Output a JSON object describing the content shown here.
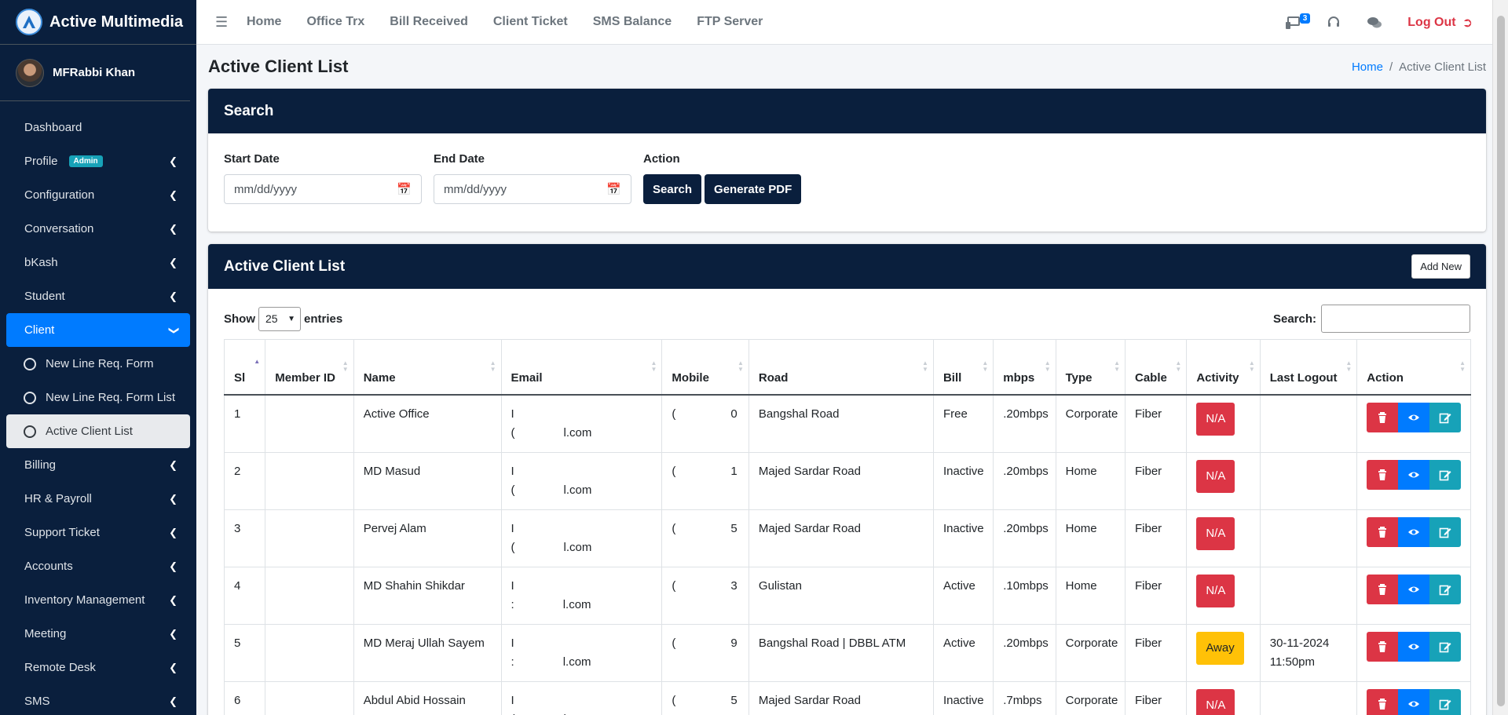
{
  "brand": {
    "name": "Active Multimedia"
  },
  "user": {
    "name": "MFRabbi Khan"
  },
  "sidebar": {
    "items": [
      {
        "label": "Dashboard"
      },
      {
        "label": "Profile",
        "badge": "Admin"
      },
      {
        "label": "Configuration"
      },
      {
        "label": "Conversation"
      },
      {
        "label": "bKash"
      },
      {
        "label": "Student"
      },
      {
        "label": "Client"
      },
      {
        "label": "New Line Req. Form"
      },
      {
        "label": "New Line Req. Form List"
      },
      {
        "label": "Active Client List"
      },
      {
        "label": "Billing"
      },
      {
        "label": "HR & Payroll"
      },
      {
        "label": "Support Ticket"
      },
      {
        "label": "Accounts"
      },
      {
        "label": "Inventory Management"
      },
      {
        "label": "Meeting"
      },
      {
        "label": "Remote Desk"
      },
      {
        "label": "SMS"
      }
    ]
  },
  "topnav": {
    "links": [
      "Home",
      "Office Trx",
      "Bill Received",
      "Client Ticket",
      "SMS Balance",
      "FTP Server"
    ],
    "notification_count": "3",
    "logout": "Log Out"
  },
  "page": {
    "title": "Active Client List",
    "breadcrumb_home": "Home",
    "breadcrumb_sep": "/",
    "breadcrumb_current": "Active Client List"
  },
  "search": {
    "title": "Search",
    "start_label": "Start Date",
    "end_label": "End Date",
    "action_label": "Action",
    "date_placeholder": "mm/dd/yyyy",
    "search_btn": "Search",
    "pdf_btn": "Generate PDF"
  },
  "list": {
    "title": "Active Client List",
    "add_new": "Add New",
    "show": "Show",
    "entries_value": "25",
    "entries": "entries",
    "search_label": "Search:",
    "columns": [
      "Sl",
      "Member ID",
      "Name",
      "Email",
      "Mobile",
      "Road",
      "Bill",
      "mbps",
      "Type",
      "Cable",
      "Activity",
      "Last Logout",
      "Action"
    ],
    "rows": [
      {
        "sl": "1",
        "name": "Active Office",
        "email_a": "I",
        "email_b": "(",
        "email_c": "l.com",
        "mobile_a": "(",
        "mobile_b": "0",
        "road": "Bangshal Road",
        "bill": "Free",
        "mbps": ".20mbps",
        "type": "Corporate",
        "cable": "Fiber",
        "activity": "N/A",
        "activity_kind": "na",
        "logout": ""
      },
      {
        "sl": "2",
        "name": "MD Masud",
        "email_a": "I",
        "email_b": "(",
        "email_c": "l.com",
        "mobile_a": "(",
        "mobile_b": "1",
        "road": "Majed Sardar Road",
        "bill": "Inactive",
        "mbps": ".20mbps",
        "type": "Home",
        "cable": "Fiber",
        "activity": "N/A",
        "activity_kind": "na",
        "logout": ""
      },
      {
        "sl": "3",
        "name": "Pervej Alam",
        "email_a": "I",
        "email_b": "(",
        "email_c": "l.com",
        "mobile_a": "(",
        "mobile_b": "5",
        "road": "Majed Sardar Road",
        "bill": "Inactive",
        "mbps": ".20mbps",
        "type": "Home",
        "cable": "Fiber",
        "activity": "N/A",
        "activity_kind": "na",
        "logout": ""
      },
      {
        "sl": "4",
        "name": "MD Shahin Shikdar",
        "email_a": "I",
        "email_b": ":",
        "email_c": "l.com",
        "mobile_a": "(",
        "mobile_b": "3",
        "road": "Gulistan",
        "bill": "Active",
        "mbps": ".10mbps",
        "type": "Home",
        "cable": "Fiber",
        "activity": "N/A",
        "activity_kind": "na",
        "logout": ""
      },
      {
        "sl": "5",
        "name": "MD Meraj Ullah Sayem",
        "email_a": "I",
        "email_b": ":",
        "email_c": "l.com",
        "mobile_a": "(",
        "mobile_b": "9",
        "road": "Bangshal Road | DBBL ATM",
        "bill": "Active",
        "mbps": ".20mbps",
        "type": "Corporate",
        "cable": "Fiber",
        "activity": "Away",
        "activity_kind": "away",
        "logout": "30-11-2024 11:50pm"
      },
      {
        "sl": "6",
        "name": "Abdul Abid Hossain",
        "email_a": "I",
        "email_b": "(",
        "email_c": "l.com",
        "mobile_a": "(",
        "mobile_b": "5",
        "road": "Majed Sardar Road",
        "bill": "Inactive",
        "mbps": ".7mbps",
        "type": "Corporate",
        "cable": "Fiber",
        "activity": "N/A",
        "activity_kind": "na",
        "logout": ""
      }
    ]
  },
  "colors": {
    "sidebar_bg": "#0a1f3d",
    "accent": "#007bff",
    "danger": "#dc3545",
    "warning": "#ffc107",
    "info": "#17a2b8"
  }
}
